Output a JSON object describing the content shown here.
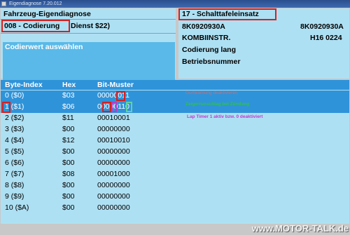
{
  "window": {
    "title": "Eigendiagnose 7.20.012"
  },
  "left_panel": {
    "title": "Fahrzeug-Eigendiagnose",
    "mode": "008 - Codierung",
    "service": "Dienst $22)",
    "action": "Codierwert auswählen"
  },
  "right_panel": {
    "module": "17 - Schalttafeleinsatz",
    "part_no_left": "8K0920930A",
    "part_no_right": "8K0920930A",
    "component": "KOMBIINSTR.",
    "version": "H16 0224",
    "coding": "Codierung lang",
    "operating_no": "Betriebsnummer"
  },
  "table": {
    "headers": [
      "Byte-Index",
      "Hex",
      "Bit-Muster"
    ],
    "rows": [
      {
        "index": "0 ($0)",
        "hex": "$03",
        "bits": "00000011"
      },
      {
        "index": "1 ($1)",
        "hex": "$06",
        "bits": "00000110"
      },
      {
        "index": "2 ($2)",
        "hex": "$11",
        "bits": "00010001"
      },
      {
        "index": "3 ($3)",
        "hex": "$00",
        "bits": "00000000"
      },
      {
        "index": "4 ($4)",
        "hex": "$12",
        "bits": "00010010"
      },
      {
        "index": "5 ($5)",
        "hex": "$00",
        "bits": "00000000"
      },
      {
        "index": "6 ($6)",
        "hex": "$00",
        "bits": "00000000"
      },
      {
        "index": "7 ($7)",
        "hex": "$08",
        "bits": "00001000"
      },
      {
        "index": "8 ($8)",
        "hex": "$00",
        "bits": "00000000"
      },
      {
        "index": "9 ($9)",
        "hex": "$00",
        "bits": "00000000"
      },
      {
        "index": "10 ($A)",
        "hex": "$00",
        "bits": "00000000"
      }
    ]
  },
  "annotations": [
    {
      "text": "Gurtwarnung deaktivieren",
      "color": "#d86a6a"
    },
    {
      "text": "Zeigerrunschlag bei Zündung",
      "color": "#2ec24a"
    },
    {
      "text": "Lap Timer 1 aktiv bzw. 0 deaktiviert",
      "color": "#c03ad0"
    }
  ],
  "colors": {
    "panel": "#aee0f3",
    "header": "#2f93d9",
    "highlight": "#d52020"
  },
  "watermark": "www.MOTOR-TALK.de"
}
